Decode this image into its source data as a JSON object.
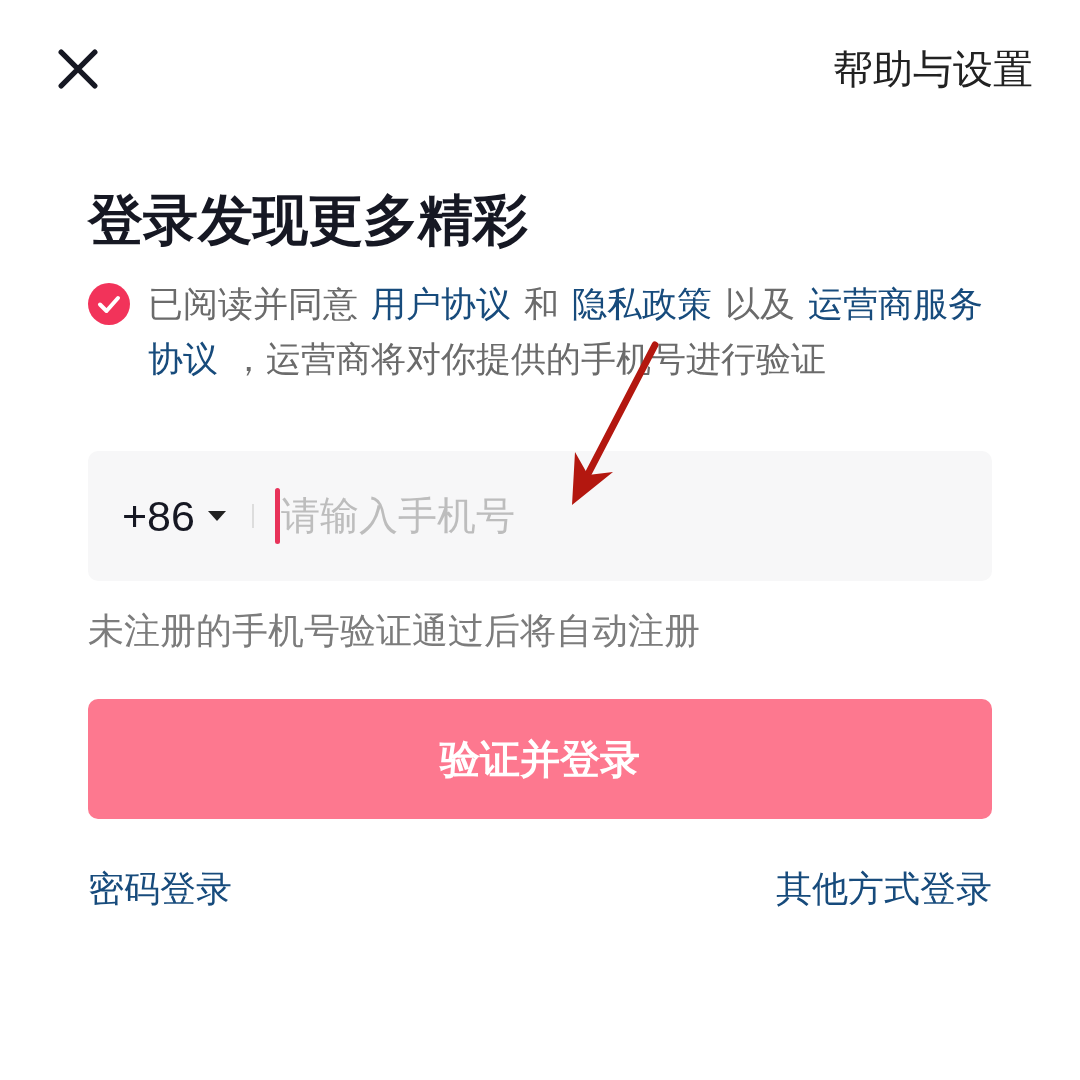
{
  "top_bar": {
    "help_settings": "帮助与设置"
  },
  "title": "登录发现更多精彩",
  "agreement": {
    "checked": true,
    "segments": [
      {
        "kind": "text",
        "text": "已阅读并同意"
      },
      {
        "kind": "link",
        "text": "用户协议"
      },
      {
        "kind": "text",
        "text": "和"
      },
      {
        "kind": "link",
        "text": "隐私政策"
      },
      {
        "kind": "text",
        "text": "以及"
      },
      {
        "kind": "link",
        "text": "运营商服务"
      },
      {
        "kind": "link",
        "text": "协议"
      },
      {
        "kind": "text",
        "text": "，运营商将对你提供的手机号进行验证"
      }
    ]
  },
  "phone_field": {
    "country_code": "+86",
    "placeholder": "请输入手机号",
    "focused": true
  },
  "hint": "未注册的手机号验证通过后将自动注册",
  "submit_button": {
    "label": "验证并登录",
    "disabled": true
  },
  "links": [
    {
      "label": "密码登录"
    },
    {
      "label": "其他方式登录"
    }
  ]
}
